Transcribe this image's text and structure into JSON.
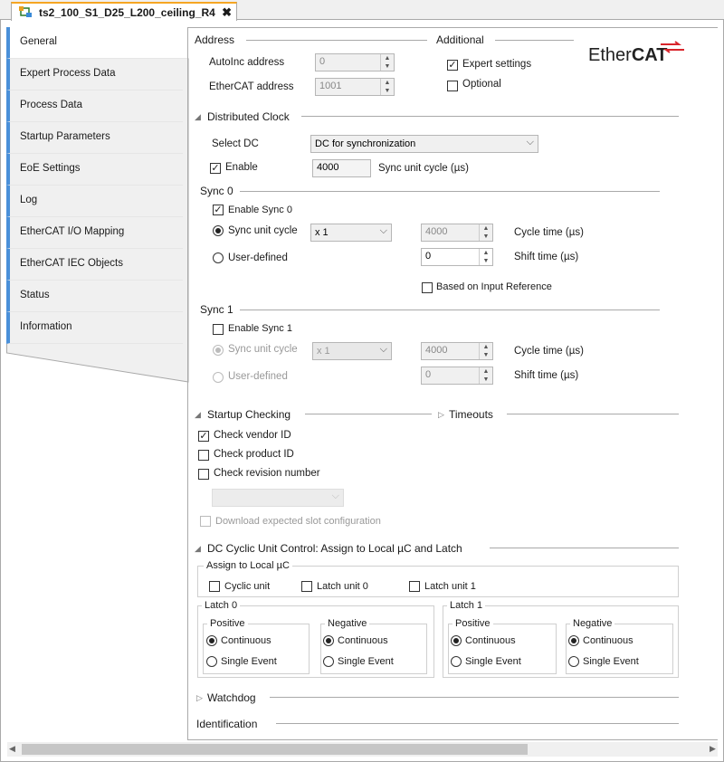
{
  "tab": {
    "title": "ts2_100_S1_D25_L200_ceiling_R4",
    "close": "✖"
  },
  "sidebar": {
    "items": [
      "General",
      "Expert Process Data",
      "Process Data",
      "Startup Parameters",
      "EoE Settings",
      "Log",
      "EtherCAT I/O Mapping",
      "EtherCAT IEC Objects",
      "Status",
      "Information"
    ]
  },
  "address": {
    "title": "Address",
    "autoinc_label": "AutoInc address",
    "autoinc_value": "0",
    "ecat_label": "EtherCAT address",
    "ecat_value": "1001"
  },
  "additional": {
    "title": "Additional",
    "expert": "Expert settings",
    "optional": "Optional",
    "logo_ether": "Ether",
    "logo_cat": "CAT"
  },
  "dc": {
    "title": "Distributed Clock",
    "select_label": "Select DC",
    "select_value": "DC for synchronization",
    "enable": "Enable",
    "cycle_value": "4000",
    "cycle_label": "Sync unit cycle (µs)"
  },
  "sync0": {
    "title": "Sync 0",
    "enable": "Enable Sync 0",
    "unit": "Sync unit cycle",
    "multiplier": "x 1",
    "cycle_value": "4000",
    "cycle_label": "Cycle time (µs)",
    "user": "User-defined",
    "shift_value": "0",
    "shift_label": "Shift time (µs)",
    "based": "Based on Input Reference"
  },
  "sync1": {
    "title": "Sync 1",
    "enable": "Enable Sync 1",
    "unit": "Sync unit cycle",
    "multiplier": "x 1",
    "cycle_value": "4000",
    "cycle_label": "Cycle time (µs)",
    "user": "User-defined",
    "shift_value": "0",
    "shift_label": "Shift time (µs)"
  },
  "startup": {
    "title": "Startup Checking",
    "timeouts": "Timeouts",
    "vendor": "Check vendor ID",
    "product": "Check product ID",
    "revision": "Check revision number",
    "download": "Download expected slot configuration"
  },
  "dcunit": {
    "title": "DC Cyclic Unit Control: Assign to Local µC and Latch",
    "assign": "Assign to Local µC",
    "cyclic": "Cyclic unit",
    "latch0": "Latch unit 0",
    "latch1": "Latch unit 1",
    "l0": "Latch 0",
    "l1": "Latch 1",
    "positive": "Positive",
    "negative": "Negative",
    "continuous": "Continuous",
    "single": "Single Event"
  },
  "watchdog": "Watchdog",
  "identification": "Identification"
}
